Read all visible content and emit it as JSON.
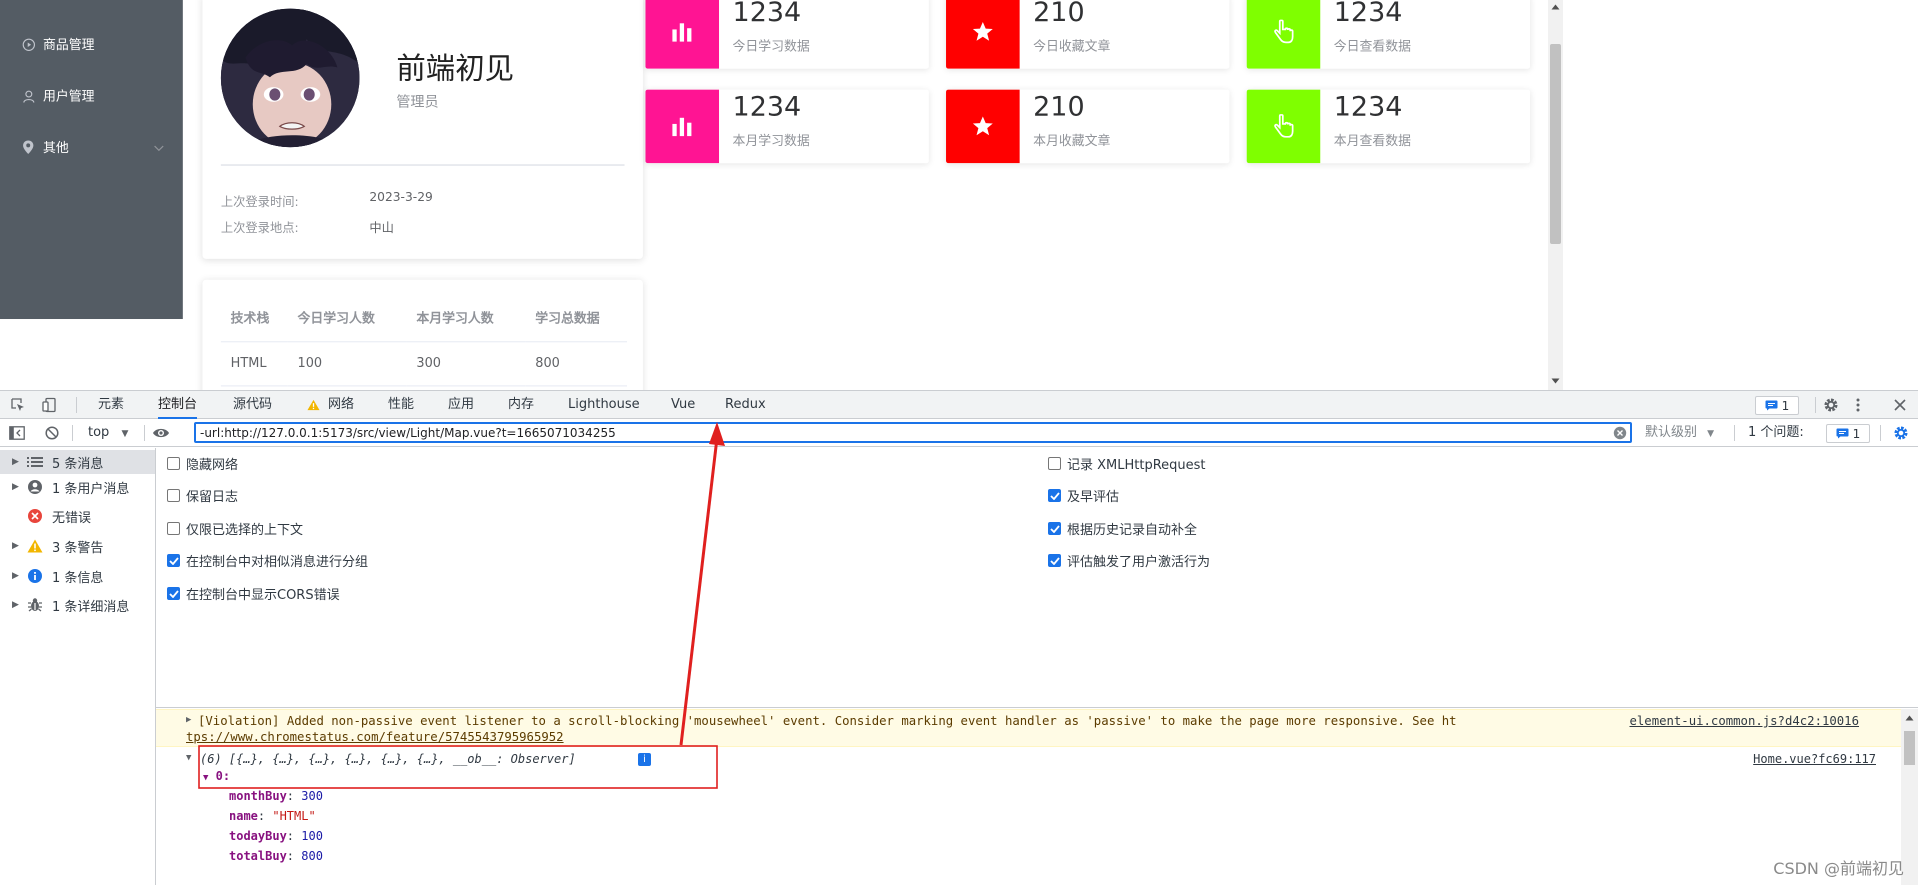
{
  "sidebar": {
    "items": [
      {
        "label": "商品管理",
        "icon": "play-circle-icon"
      },
      {
        "label": "用户管理",
        "icon": "user-icon"
      },
      {
        "label": "其他",
        "icon": "location-icon",
        "has_submenu": true
      }
    ]
  },
  "user_card": {
    "name": "前端初见",
    "role": "管理员",
    "last_login_time_label": "上次登录时间:",
    "last_login_time": "2023-3-29",
    "last_login_place_label": "上次登录地点:",
    "last_login_place": "中山"
  },
  "stats": [
    {
      "value": "1234",
      "label": "今日学习数据",
      "icon": "bar-chart-icon",
      "color": "#ff1493"
    },
    {
      "value": "210",
      "label": "今日收藏文章",
      "icon": "star-icon",
      "color": "#ff0000"
    },
    {
      "value": "1234",
      "label": "今日查看数据",
      "icon": "pointer-hand-icon",
      "color": "#7fff00"
    },
    {
      "value": "1234",
      "label": "本月学习数据",
      "icon": "bar-chart-icon",
      "color": "#ff1493"
    },
    {
      "value": "210",
      "label": "本月收藏文章",
      "icon": "star-icon",
      "color": "#ff0000"
    },
    {
      "value": "1234",
      "label": "本月查看数据",
      "icon": "pointer-hand-icon",
      "color": "#7fff00"
    }
  ],
  "table": {
    "headers": [
      "技术栈",
      "今日学习人数",
      "本月学习人数",
      "学习总数据"
    ],
    "rows": [
      [
        "HTML",
        "100",
        "300",
        "800"
      ]
    ]
  },
  "devtools": {
    "tabs": [
      "元素",
      "控制台",
      "源代码",
      "网络",
      "性能",
      "应用",
      "内存",
      "Lighthouse",
      "Vue",
      "Redux"
    ],
    "active_tab": "控制台",
    "issues_badge": "1",
    "context": "top",
    "filter_value": "-url:http://127.0.0.1:5173/src/view/Light/Map.vue?t=1665071034255",
    "level": "默认级别",
    "issues_label": "1 个问题:",
    "issues_count": "1",
    "side_items": [
      {
        "label": "5 条消息",
        "icon": "list-icon"
      },
      {
        "label": "1 条用户消息",
        "icon": "user-circle-icon"
      },
      {
        "label": "无错误",
        "icon": "error-icon"
      },
      {
        "label": "3 条警告",
        "icon": "warning-icon"
      },
      {
        "label": "1 条信息",
        "icon": "info-icon"
      },
      {
        "label": "1 条详细消息",
        "icon": "bug-icon"
      }
    ],
    "settings_left": [
      {
        "label": "隐藏网络",
        "checked": false
      },
      {
        "label": "保留日志",
        "checked": false
      },
      {
        "label": "仅限已选择的上下文",
        "checked": false
      },
      {
        "label": "在控制台中对相似消息进行分组",
        "checked": true
      },
      {
        "label": "在控制台中显示CORS错误",
        "checked": true
      }
    ],
    "settings_right": [
      {
        "label": "记录 XMLHttpRequest",
        "checked": false
      },
      {
        "label": "及早评估",
        "checked": true
      },
      {
        "label": "根据历史记录自动补全",
        "checked": true
      },
      {
        "label": "评估触发了用户激活行为",
        "checked": true
      }
    ],
    "violation_text": "[Violation] Added non-passive event listener to a scroll-blocking 'mousewheel' event. Consider marking event handler as 'passive' to make the page more responsive. See ht",
    "violation_text_2": "tps://www.chromestatus.com/feature/5745543795965952",
    "violation_source": "element-ui.common.js?d4c2:10016",
    "log_summary": "(6) [{…}, {…}, {…}, {…}, {…}, {…}, __ob__: Observer]",
    "log_source": "Home.vue?fc69:117",
    "log_index": "0:",
    "log_props": [
      {
        "key": "monthBuy",
        "value": "300",
        "type": "number"
      },
      {
        "key": "name",
        "value": "\"HTML\"",
        "type": "string"
      },
      {
        "key": "todayBuy",
        "value": "100",
        "type": "number"
      },
      {
        "key": "totalBuy",
        "value": "800",
        "type": "number"
      }
    ]
  },
  "watermark": "CSDN @前端初见",
  "annotation_color": "#e0201f"
}
